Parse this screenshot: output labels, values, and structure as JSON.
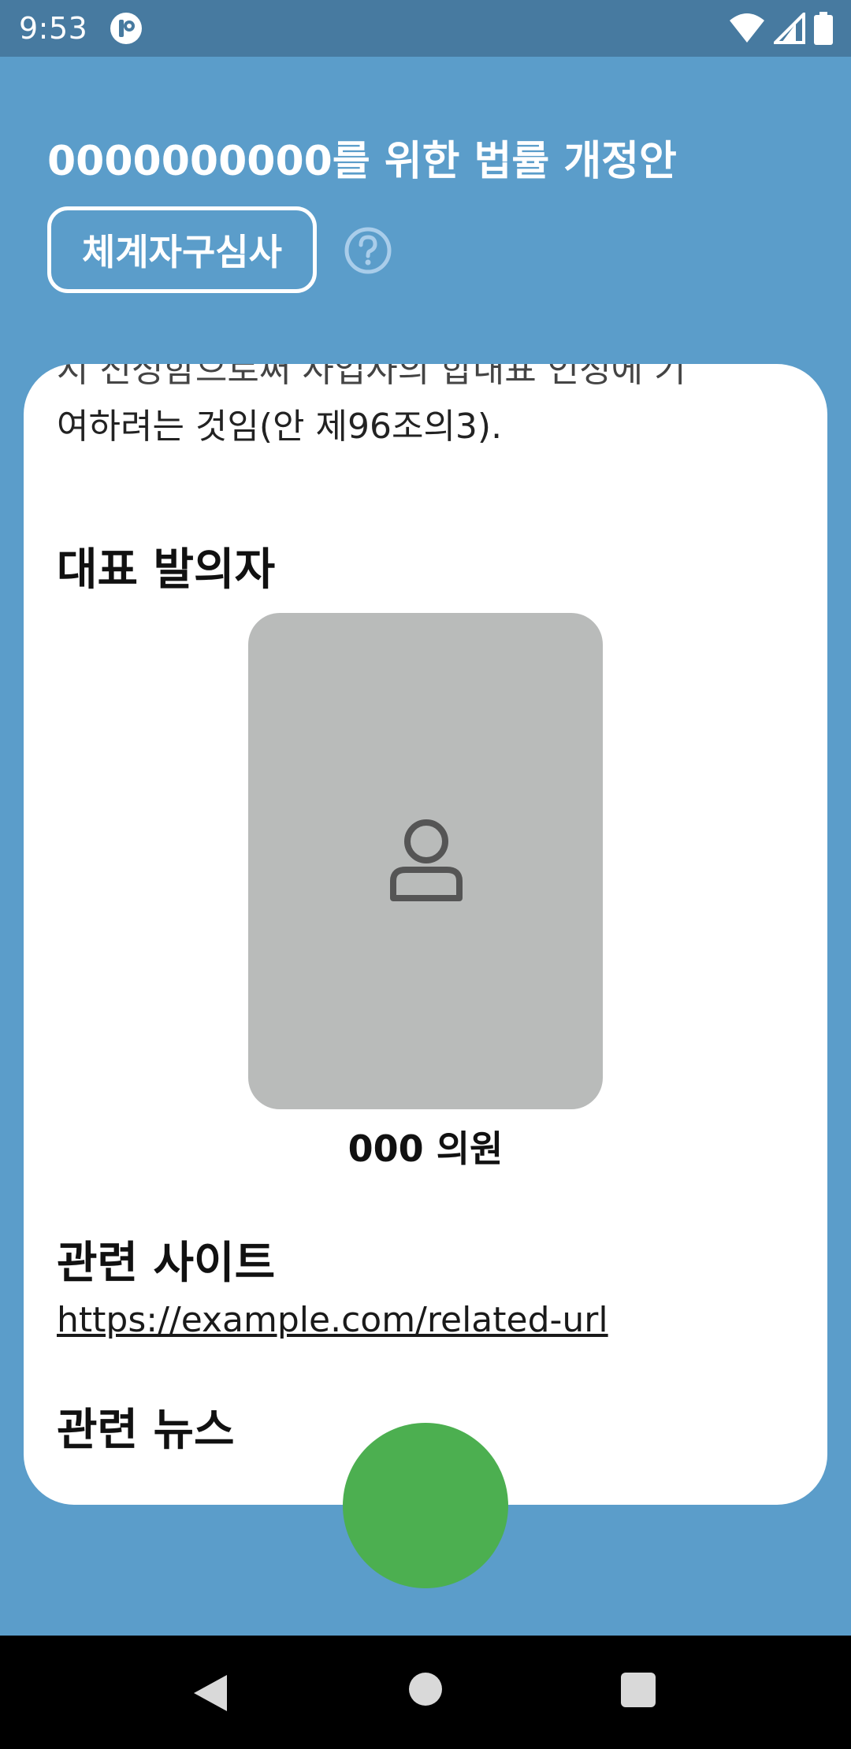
{
  "status_bar": {
    "time": "9:53",
    "icons": [
      "app-notification-icon",
      "wifi-icon",
      "cell-signal-icon",
      "battery-icon"
    ]
  },
  "header": {
    "title": "0000000000를 위한 법률 개정안",
    "stage_badge": "체계자구심사",
    "help_icon": "help-circle-icon"
  },
  "card": {
    "summary_partial_line": "시 전성함으로써 사업사의 합내표 인정에 기",
    "summary_last_line": "여하려는 것임(안 제96조의3).",
    "sponsor_heading": "대표 발의자",
    "sponsor_name": "000 의원",
    "sponsor_photo_icon": "person-placeholder-icon",
    "related_site_heading": "관련 사이트",
    "related_site_url": "https://example.com/related-url",
    "related_news_heading": "관련 뉴스"
  },
  "colors": {
    "background": "#5b9dca",
    "status_bar": "#477aa0",
    "card": "#ffffff",
    "fab": "#4caf50",
    "photo_placeholder": "#b9bbba"
  },
  "nav_bar": {
    "buttons": [
      "back-icon",
      "home-icon",
      "recent-apps-icon"
    ]
  }
}
